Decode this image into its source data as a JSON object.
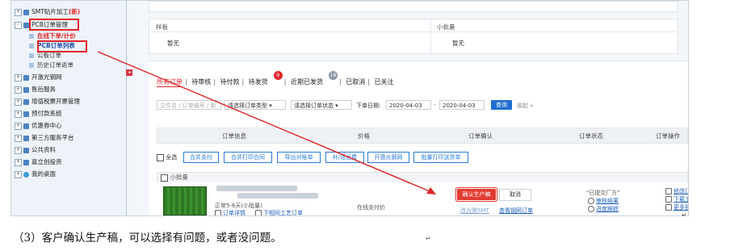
{
  "sidebar": {
    "items": [
      {
        "label": "SMT贴片加工",
        "badge": "(新)"
      },
      {
        "label": "PCB订单管理"
      },
      {
        "label": "开激光钢网"
      },
      {
        "label": "售后服务"
      },
      {
        "label": "增值税票开票管理"
      },
      {
        "label": "预付款系统"
      },
      {
        "label": "优惠券中心"
      },
      {
        "label": "第三方服务平台"
      },
      {
        "label": "公共资料"
      },
      {
        "label": "嘉立创投资"
      },
      {
        "label": "我的桌面"
      }
    ],
    "subitems": [
      {
        "label": "在线下单/计价"
      },
      {
        "label": "PCB订单列表"
      },
      {
        "label": "公板订单"
      },
      {
        "label": "历史订单返单"
      }
    ]
  },
  "top_table": {
    "col1_header": "样板",
    "col2_header": "小批量",
    "col1_value": "暂无",
    "col2_value": "暂无"
  },
  "tabs": [
    {
      "label": "所有订单"
    },
    {
      "label": "待审核"
    },
    {
      "label": "待付款"
    },
    {
      "label": "待发货",
      "badge": "9"
    },
    {
      "label": "近期已发货",
      "badge": "18"
    },
    {
      "label": "已取消"
    },
    {
      "label": "已关注"
    }
  ],
  "filters": {
    "search_placeholder": "文件名 / 订单编号 / 新",
    "type_select": "请选择订单类型",
    "status_select": "请选择订单状态",
    "date_label": "下单日期:",
    "date_from": "2020-04-03",
    "date_dash": "-",
    "date_to": "2020-04-03",
    "query_button": "查询",
    "collapse_label": "收起"
  },
  "columns": [
    "订单信息",
    "价格",
    "订单确认",
    "订单状态",
    "订单操作"
  ],
  "actions": {
    "select_all": "全选",
    "merge_pay": "合并支付",
    "merge_print": "合并打印合同",
    "export_statement": "导出对账单",
    "refund_freight": "补/退运费",
    "laser_stencil": "开激光钢网",
    "batch_print_shipping": "批量打印送货单"
  },
  "order": {
    "group_label": "小批量",
    "desc": "正常5-6天(小批量)",
    "link_confirm": "订单详情",
    "link_process": "下相同工艺订单",
    "price_note": "在线支付价",
    "confirm_production": "确认生产稿",
    "cancel": "取消",
    "to_smt": "改为需SMT",
    "view_stencil": "查看钢网订单",
    "status_text": "\"已提交厂方\"",
    "status_link1": "审核结果",
    "status_link2": "进度跟踪",
    "op_link1": "修改订单",
    "op_link2": "下载工程文",
    "op_link3": "更多操作"
  },
  "caption": "（3）客户确认生产稿，可以选择有问题，或者没问题。",
  "colors": {
    "accent_red": "#e0262a",
    "link_blue": "#1f5fb8",
    "button_blue": "#1f6fcf"
  }
}
